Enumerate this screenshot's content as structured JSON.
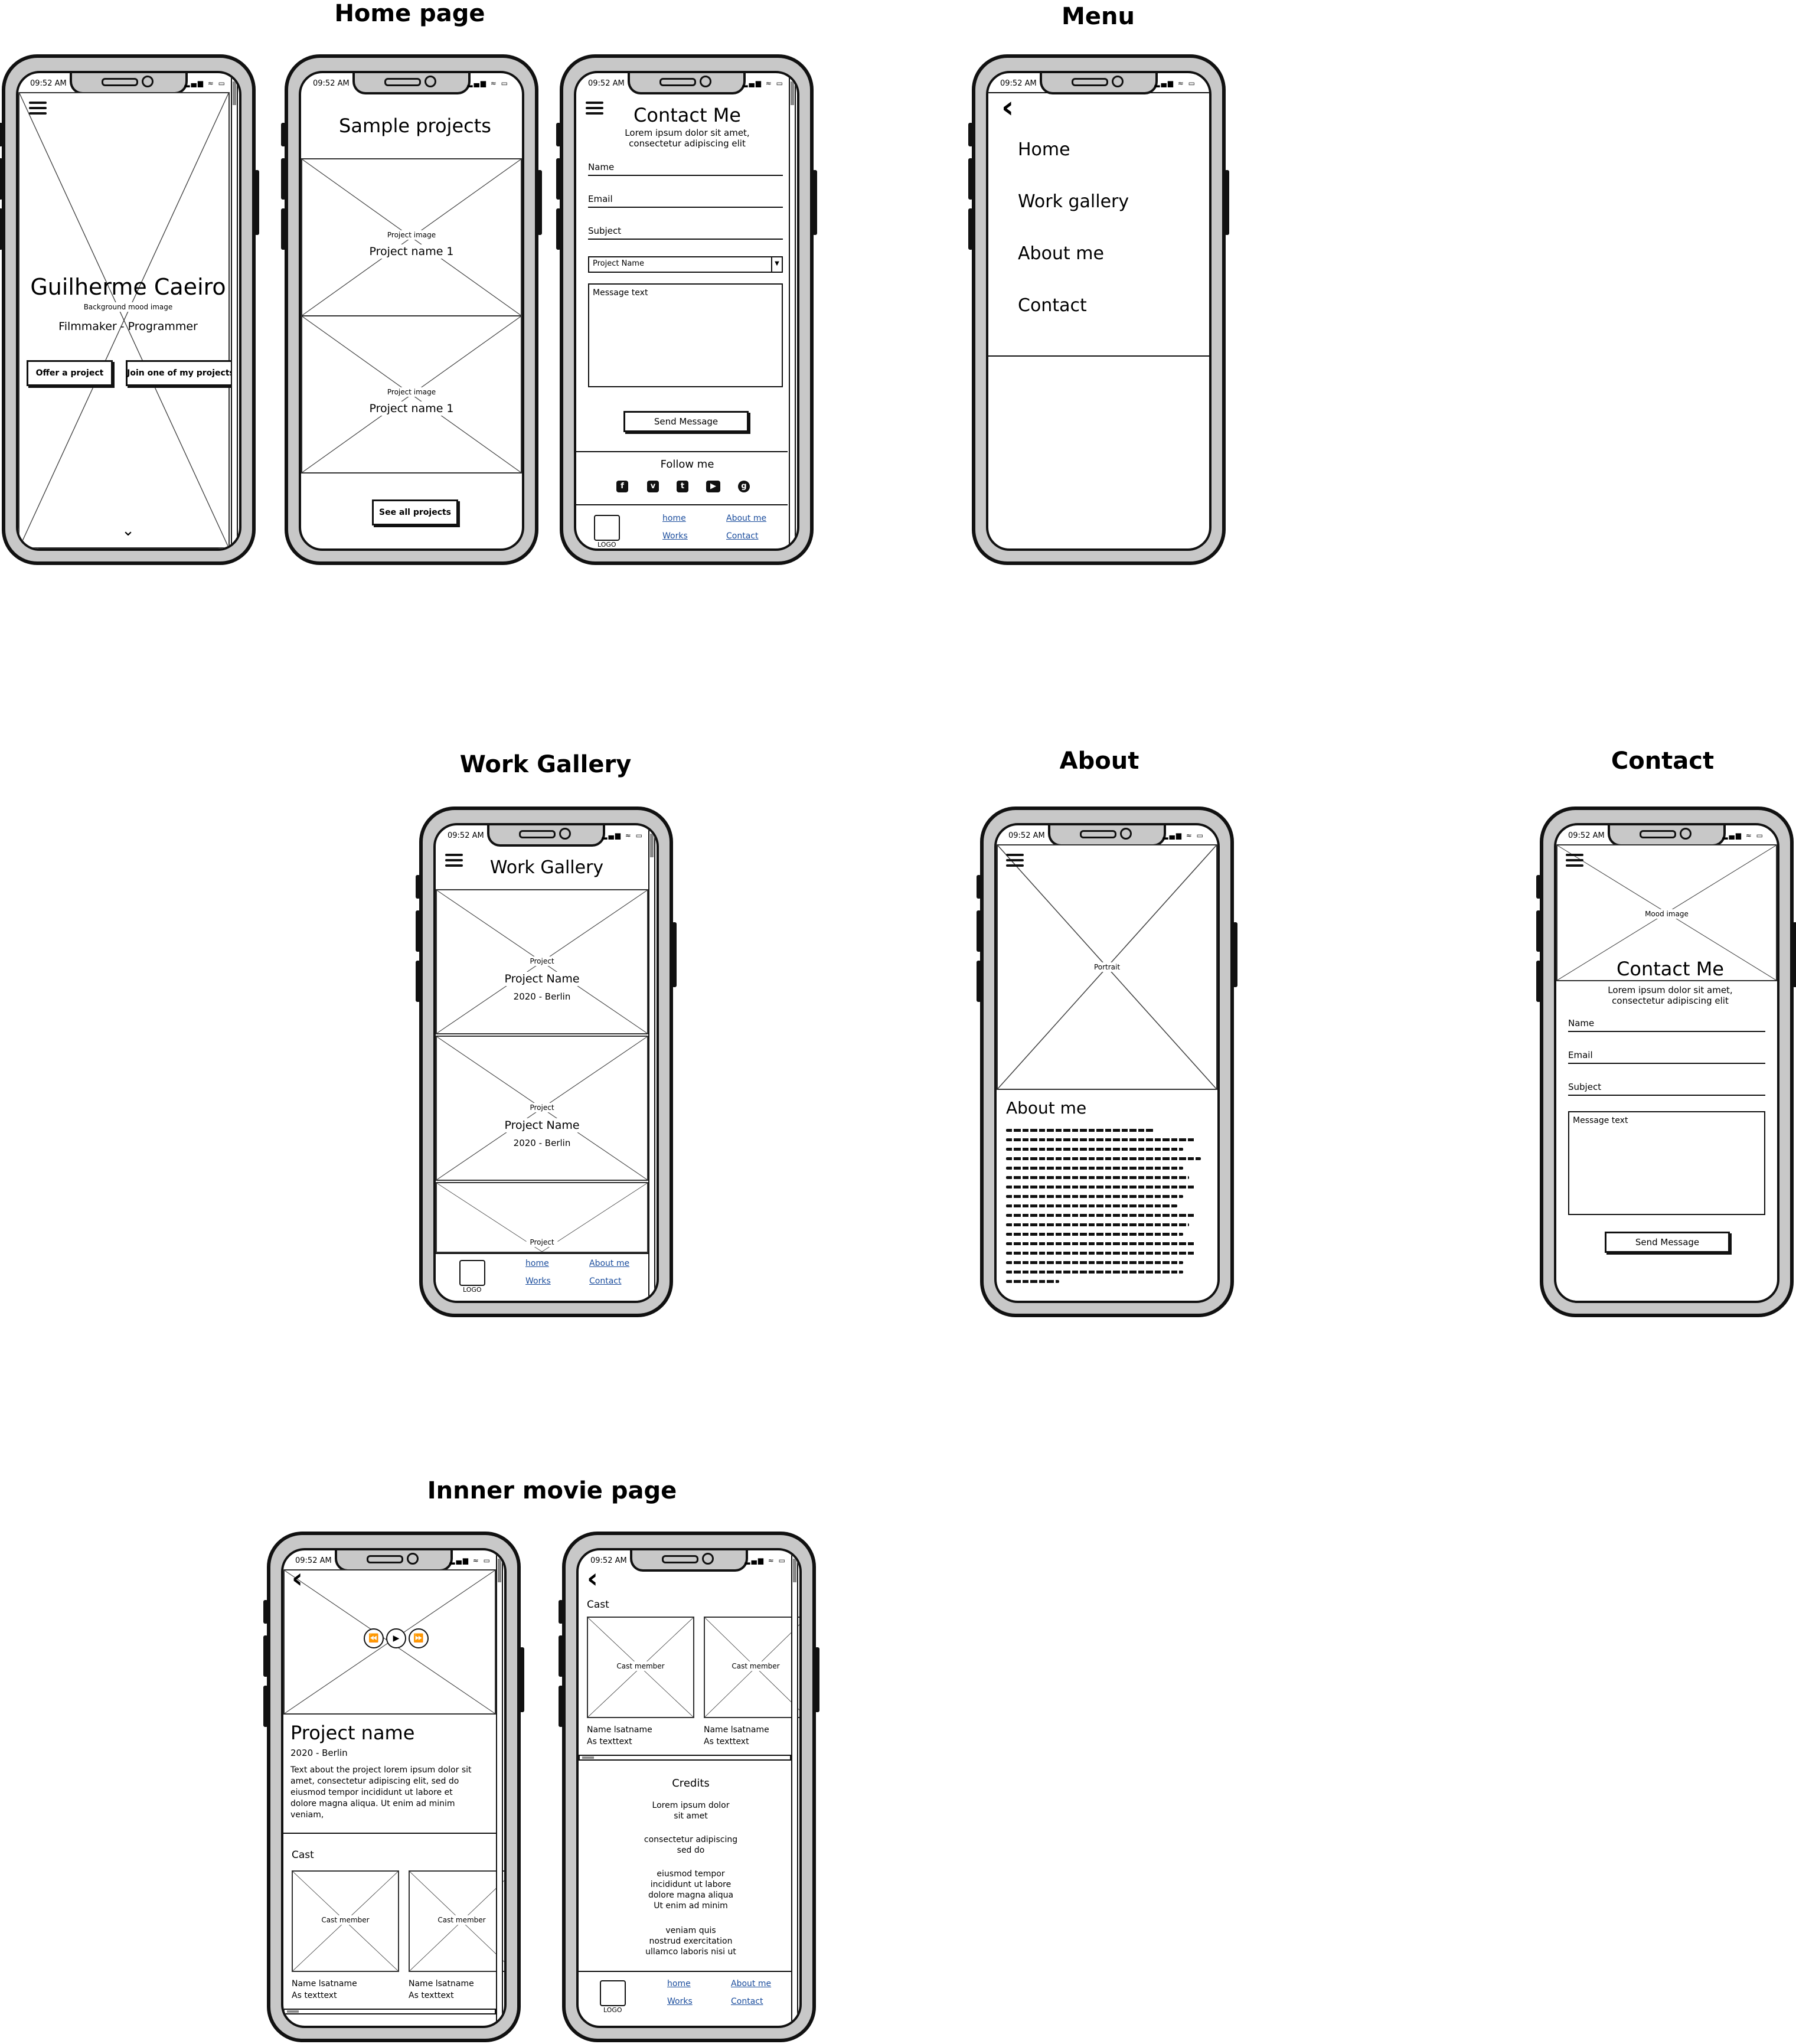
{
  "sections": {
    "home_page": "Home page",
    "menu": "Menu",
    "work_gallery": "Work Gallery",
    "about": "About",
    "contact": "Contact",
    "inner_movie": "Innner movie page"
  },
  "status": {
    "time": "09:52 AM",
    "icons": "▂▄▆ ≈ ▭"
  },
  "home1": {
    "name": "Guilherme Caeiro",
    "bg_label": "Background mood image",
    "tagline": "Filmmaker - Programmer",
    "btn_offer": "Offer a project",
    "btn_join": "Join one of my projects",
    "chevron": "⌄"
  },
  "home2": {
    "title": "Sample projects",
    "p1_label": "Project image",
    "p1_name": "Project name 1",
    "p2_label": "Project image",
    "p2_name": "Project name 1",
    "btn_all": "See all projects"
  },
  "home3": {
    "title": "Contact Me",
    "subtitle1": "Lorem ipsum dolor sit amet,",
    "subtitle2": "consectetur adipiscing elit",
    "name": "Name",
    "email": "Email",
    "subject": "Subject",
    "select": "Project Name",
    "message": "Message text",
    "send": "Send Message",
    "follow": "Follow me"
  },
  "footer": {
    "logo": "LOGO",
    "home": "home",
    "works": "Works",
    "about": "About me",
    "contact": "Contact"
  },
  "menu": {
    "back": "‹",
    "items": [
      "Home",
      "Work gallery",
      "About me",
      "Contact"
    ]
  },
  "gallery": {
    "title": "Work Gallery",
    "items": [
      {
        "label": "Project",
        "name": "Project Name",
        "meta": "2020 - Berlin"
      },
      {
        "label": "Project",
        "name": "Project Name",
        "meta": "2020 - Berlin"
      },
      {
        "label": "Project"
      }
    ]
  },
  "about": {
    "portrait": "Portrait",
    "heading": "About me"
  },
  "contact": {
    "mood": "Mood image",
    "title": "Contact Me",
    "subtitle1": "Lorem ipsum dolor sit amet,",
    "subtitle2": "consectetur adipiscing elit",
    "name": "Name",
    "email": "Email",
    "subject": "Subject",
    "message": "Message text",
    "send": "Send Message"
  },
  "movie1": {
    "title": "Project name",
    "meta": "2020 - Berlin",
    "desc": [
      "Text about the project lorem ipsum dolor sit",
      "amet, consectetur adipiscing elit, sed do",
      "eiusmod tempor incididunt ut labore et",
      "dolore magna aliqua. Ut enim ad minim",
      "veniam,"
    ],
    "cast": "Cast",
    "members": [
      {
        "label": "Cast member",
        "name": "Name lsatname",
        "role": "As texttext"
      },
      {
        "label": "Cast member",
        "name": "Name lsatname",
        "role": "As texttext"
      }
    ]
  },
  "movie2": {
    "cast": "Cast",
    "members": [
      {
        "label": "Cast member",
        "name": "Name lsatname",
        "role": "As texttext"
      },
      {
        "label": "Cast member",
        "name": "Name lsatname",
        "role": "As texttext"
      }
    ],
    "credits": "Credits",
    "credit_lines": [
      "Lorem ipsum dolor",
      "sit amet",
      "",
      "consectetur adipiscing",
      "sed do",
      "",
      "eiusmod tempor",
      "incididunt ut labore",
      "dolore magna aliqua",
      "Ut enim ad minim",
      "",
      "veniam quis",
      "nostrud exercitation",
      "ullamco laboris nisi ut"
    ]
  },
  "icons": {
    "hamburger": "hamburger-menu-icon",
    "back": "back-chevron-icon",
    "facebook": "facebook-icon",
    "vimeo": "vimeo-icon",
    "twitter": "twitter-icon",
    "youtube": "youtube-icon",
    "github": "github-icon"
  }
}
